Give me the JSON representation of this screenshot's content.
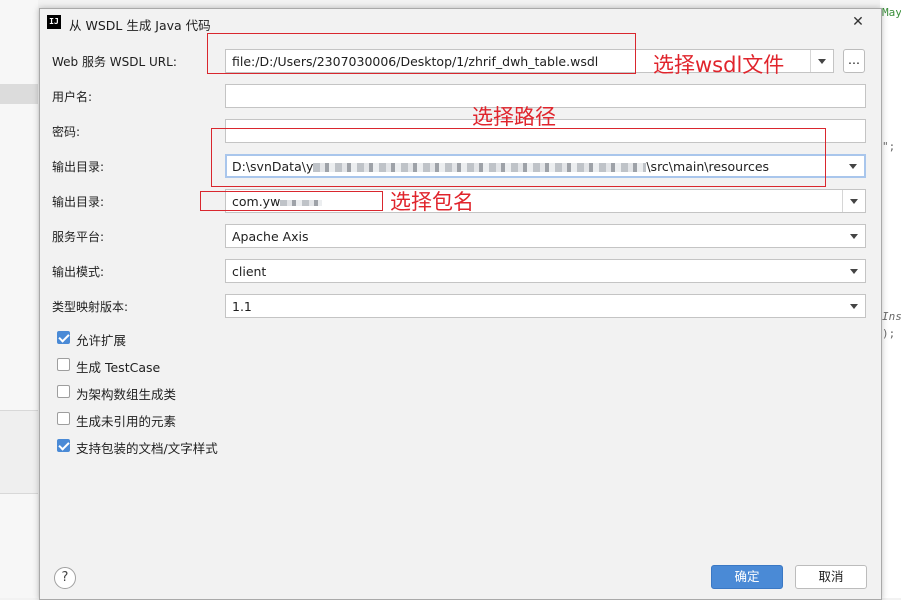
{
  "background": {
    "code_right": [
      "May",
      "\";",
      "Ins",
      ");"
    ]
  },
  "dialog": {
    "title": "从 WSDL 生成 Java 代码",
    "app_icon_text": "IJ",
    "fields": {
      "wsdl_url": {
        "label": "Web 服务 WSDL URL:",
        "value": "file:/D:/Users/2307030006/Desktop/1/zhrif_dwh_table.wsdl",
        "browse": "..."
      },
      "username": {
        "label": "用户名:",
        "value": ""
      },
      "password": {
        "label": "密码:",
        "value": ""
      },
      "output_dir": {
        "label": "输出目录:",
        "value_prefix": "D:\\svnData\\y",
        "value_suffix": "\\src\\main\\resources"
      },
      "package": {
        "label": "输出目录:",
        "value_prefix": "com.yw"
      },
      "platform": {
        "label": "服务平台:",
        "value": "Apache Axis"
      },
      "output_mode": {
        "label": "输出模式:",
        "value": "client"
      },
      "type_mapping": {
        "label": "类型映射版本:",
        "value": "1.1"
      }
    },
    "checkboxes": [
      {
        "label": "允许扩展",
        "checked": true
      },
      {
        "label": "生成 TestCase",
        "checked": false
      },
      {
        "label": "为架构数组生成类",
        "checked": false
      },
      {
        "label": "生成未引用的元素",
        "checked": false
      },
      {
        "label": "支持包装的文档/文字样式",
        "checked": true
      }
    ],
    "buttons": {
      "ok": "确定",
      "cancel": "取消",
      "help": "?"
    },
    "annotations": {
      "wsdl": "选择wsdl文件",
      "path": "选择路径",
      "package": "选择包名"
    }
  }
}
